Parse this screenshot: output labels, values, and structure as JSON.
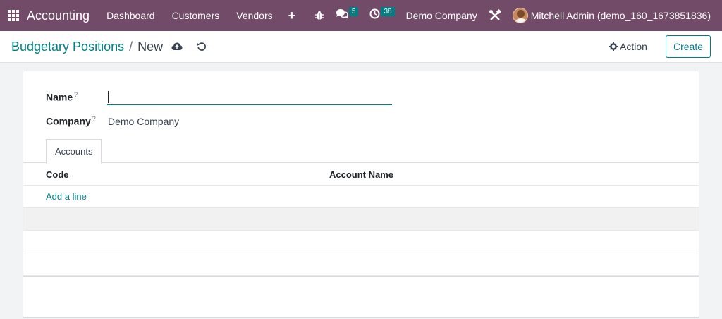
{
  "navbar": {
    "app_name": "Accounting",
    "menu": [
      "Dashboard",
      "Customers",
      "Vendors"
    ],
    "messages_count": "5",
    "activities_count": "38",
    "company": "Demo Company",
    "user": "Mitchell Admin (demo_160_1673851836)"
  },
  "breadcrumb": {
    "parent": "Budgetary Positions",
    "separator": "/",
    "current": "New"
  },
  "control": {
    "action_label": "Action",
    "create_label": "Create"
  },
  "form": {
    "name_label": "Name",
    "name_help": "?",
    "name_value": "",
    "company_label": "Company",
    "company_help": "?",
    "company_value": "Demo Company"
  },
  "tabs": [
    {
      "label": "Accounts"
    }
  ],
  "accounts_table": {
    "columns": [
      "Code",
      "Account Name"
    ],
    "add_line_label": "Add a line"
  },
  "colors": {
    "navbar": "#714b67",
    "accent": "#017e84"
  }
}
